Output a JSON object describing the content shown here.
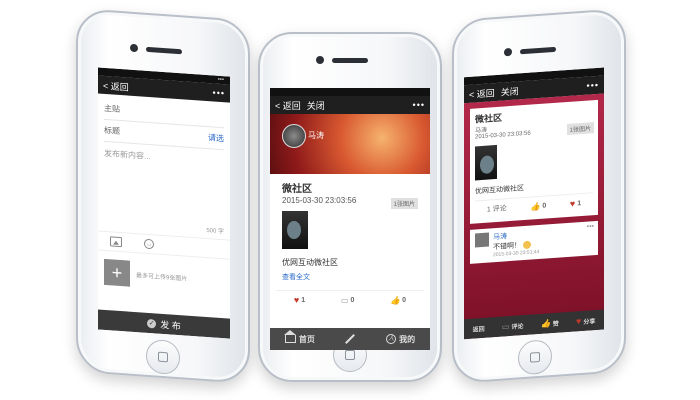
{
  "left_phone": {
    "status_dots": "•••",
    "nav": {
      "back": "< 返回",
      "menu": "•••"
    },
    "compose": {
      "topic_label": "主贴",
      "category_placeholder": "标题",
      "select_label": "请选",
      "body_placeholder": "发布新内容...",
      "counter": "500 字"
    },
    "upload_hint": "最多可上传9张图片",
    "publish_label": "发 布",
    "icons": [
      "image-icon",
      "smile-icon",
      "plus-icon",
      "check-icon"
    ]
  },
  "center_phone": {
    "nav": {
      "back": "< 返回",
      "close": "关闭",
      "menu": "•••"
    },
    "user_name": "马涛",
    "post": {
      "title": "微社区",
      "time": "2015-03-30 23:03:56",
      "badge": "1张图片",
      "text": "优网互动微社区",
      "more": "查看全文"
    },
    "actions": {
      "likes": "1",
      "comments": "0",
      "thumbs": "0"
    },
    "tabs": [
      "首页",
      "",
      "我的"
    ]
  },
  "right_phone": {
    "nav": {
      "back": "< 返回",
      "close": "关闭",
      "menu": "•••"
    },
    "post": {
      "title": "微社区",
      "author": "马涛",
      "time": "2015-03-30 23:03:56",
      "badge": "1张图片",
      "text": "优网互动微社区"
    },
    "actions": {
      "comments_label": "1 评论",
      "thumbs": "0",
      "likes": "1"
    },
    "comment": {
      "name": "马涛",
      "text": "不错啊！",
      "time": "2015-03-30 23:51:44",
      "menu": "•••"
    },
    "bottom": [
      "返回",
      "评论",
      "赞",
      "分享"
    ]
  },
  "colors": {
    "accent_blue": "#2a68c7",
    "like_red": "#c0392b",
    "bar_dark": "#1f1f1f"
  }
}
